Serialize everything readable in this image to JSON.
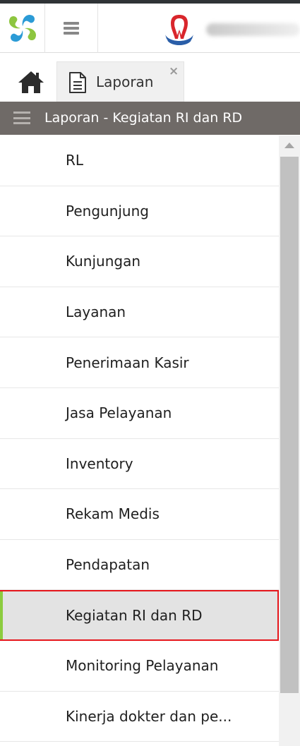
{
  "header": {
    "menu_icon": "hamburger-icon",
    "app_logo_icon": "pinwheel-logo",
    "hospital_logo_icon": "tooth-shield-logo"
  },
  "tabs": {
    "home_icon": "home-icon",
    "items": [
      {
        "label": "Laporan",
        "icon": "document-icon",
        "close": "×"
      }
    ]
  },
  "section": {
    "title": "Laporan - Kegiatan RI dan RD",
    "menu_icon": "hamburger-icon"
  },
  "menu": {
    "items": [
      {
        "label": "RL"
      },
      {
        "label": "Pengunjung"
      },
      {
        "label": "Kunjungan"
      },
      {
        "label": "Layanan"
      },
      {
        "label": "Penerimaan Kasir"
      },
      {
        "label": "Jasa Pelayanan"
      },
      {
        "label": "Inventory"
      },
      {
        "label": "Rekam Medis"
      },
      {
        "label": "Pendapatan"
      },
      {
        "label": "Kegiatan RI dan RD",
        "active": true
      },
      {
        "label": "Monitoring Pelayanan"
      },
      {
        "label": "Kinerja dokter dan pe..."
      }
    ]
  },
  "colors": {
    "section_header_bg": "#6f6a67",
    "active_border": "#e6161c",
    "active_accent": "#8ccc3f",
    "logo_blue": "#2b9bd6",
    "logo_green": "#8dc63f"
  }
}
